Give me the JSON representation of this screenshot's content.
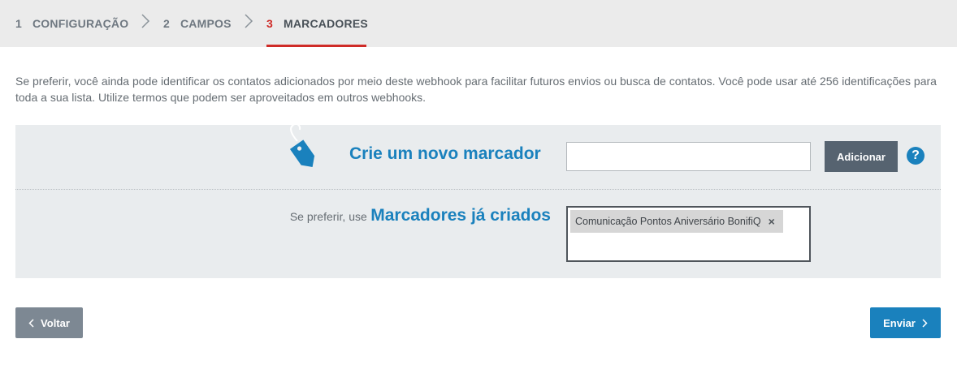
{
  "stepper": {
    "steps": [
      {
        "number": "1",
        "label": "CONFIGURAÇÃO",
        "active": false
      },
      {
        "number": "2",
        "label": "CAMPOS",
        "active": false
      },
      {
        "number": "3",
        "label": "MARCADORES",
        "active": true
      }
    ]
  },
  "intro_text": "Se preferir, você ainda pode identificar os contatos adicionados por meio deste webhook para facilitar futuros envios ou busca de contatos. Você pode usar até 256 identificações para toda a sua lista. Utilize termos que podem ser aproveitados em outros webhooks.",
  "new_tag": {
    "icon": "tag-icon",
    "title": "Crie um novo marcador",
    "input_value": "",
    "add_label": "Adicionar",
    "help_icon": "?"
  },
  "existing": {
    "prefix": "Se preferir, use",
    "title": "Marcadores já criados",
    "tags": [
      {
        "label": "Comunicação Pontos Aniversário BonifiQ",
        "remove": "×"
      }
    ]
  },
  "footer": {
    "back_label": "Voltar",
    "send_label": "Enviar"
  },
  "colors": {
    "accent": "#1a81bd",
    "active_step": "#cf2b27",
    "panel": "#e9ecee"
  }
}
